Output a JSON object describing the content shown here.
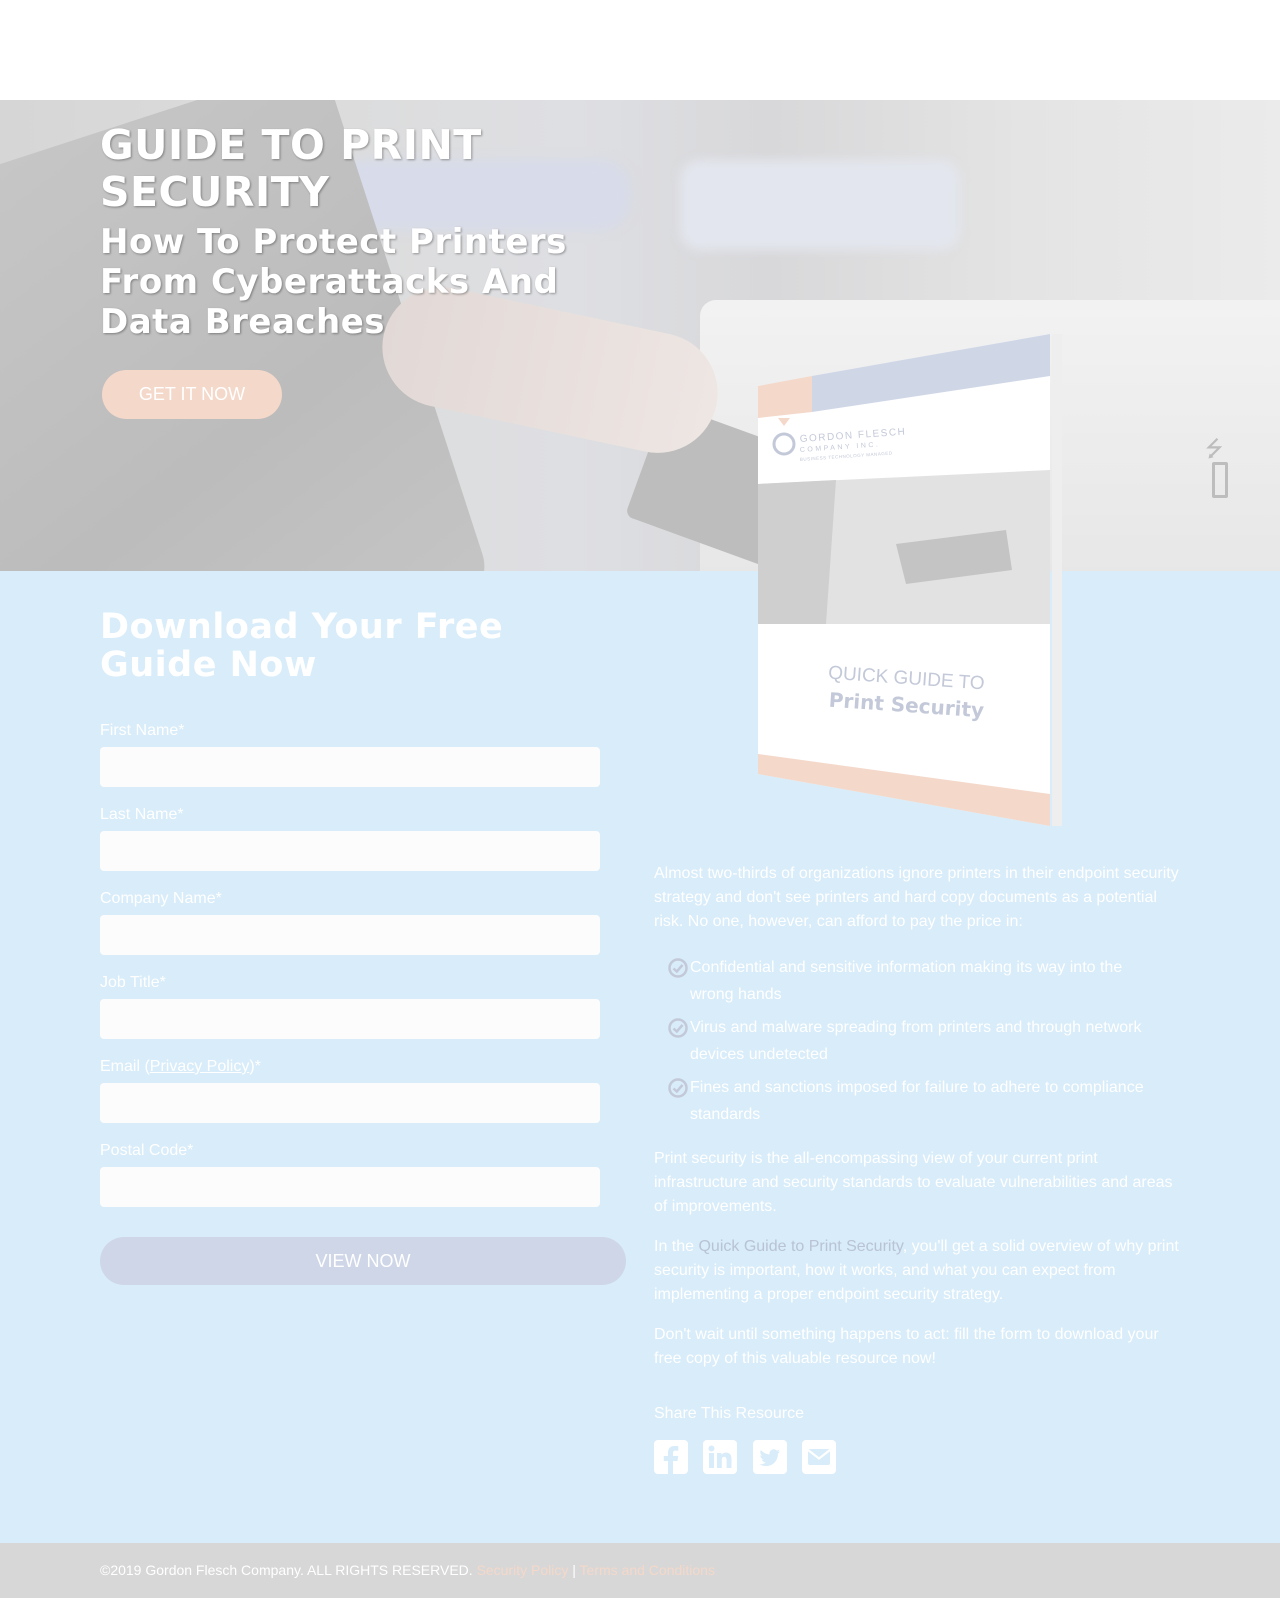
{
  "hero": {
    "title": "GUIDE TO PRINT SECURITY",
    "subtitle": "How To Protect Printers From Cyberattacks And Data Breaches",
    "cta_label": "GET IT NOW"
  },
  "form": {
    "heading": "Download Your Free Guide Now",
    "fields": {
      "first_name": {
        "label": "First Name*",
        "value": ""
      },
      "last_name": {
        "label": "Last Name*",
        "value": ""
      },
      "company_name": {
        "label": "Company Name*",
        "value": ""
      },
      "job_title": {
        "label": "Job Title*",
        "value": ""
      },
      "email": {
        "label_prefix": "Email (",
        "link": "Privacy Policy",
        "label_suffix": ")*",
        "value": ""
      },
      "postal_code": {
        "label": "Postal Code*",
        "value": ""
      }
    },
    "submit_label": "VIEW NOW"
  },
  "book": {
    "brand_line1": "GORDON FLESCH",
    "brand_line2": "COMPANY INC.",
    "brand_tagline": "BUSINESS TECHNOLOGY MANAGED",
    "title_line1": "QUICK GUIDE TO",
    "title_line2": "Print Security"
  },
  "description": {
    "intro": "Almost two-thirds of organizations ignore printers in their endpoint security strategy and don't see printers and hard copy documents as a potential risk. No one, however, can afford to pay the price in:",
    "bullets": [
      "Confidential and sensitive information making its way into the wrong hands",
      "Virus and malware spreading from printers and through network devices undetected",
      "Fines and sanctions imposed for failure to adhere to compliance standards"
    ],
    "paragraph2": "Print security is the all-encompassing view of your current print infrastructure and security standards to evaluate vulnerabilities and areas of improvements.",
    "paragraph3_prefix": "In the ",
    "paragraph3_highlight": "Quick Guide to Print Security",
    "paragraph3_suffix": ", you'll get a solid overview of why print security is important, how it works, and what you can expect from implementing a proper endpoint security strategy.",
    "paragraph4": "Don't wait until something happens to act: fill the form to download your free copy of this valuable resource now!"
  },
  "share": {
    "label": "Share This Resource",
    "icons": [
      "facebook-icon",
      "linkedin-icon",
      "twitter-icon",
      "email-icon"
    ]
  },
  "footer": {
    "copyright": "©2019 Gordon Flesch Company. ALL RIGHTS RESERVED.",
    "security_policy": "Security Policy",
    "separator": "|",
    "terms": "Terms and Conditions"
  },
  "colors": {
    "content_bg": "#d8ecf9",
    "cta_peach": "#f4d8ca",
    "submit_blue": "#ced6e8",
    "footer_bg": "#d7d7d7"
  }
}
